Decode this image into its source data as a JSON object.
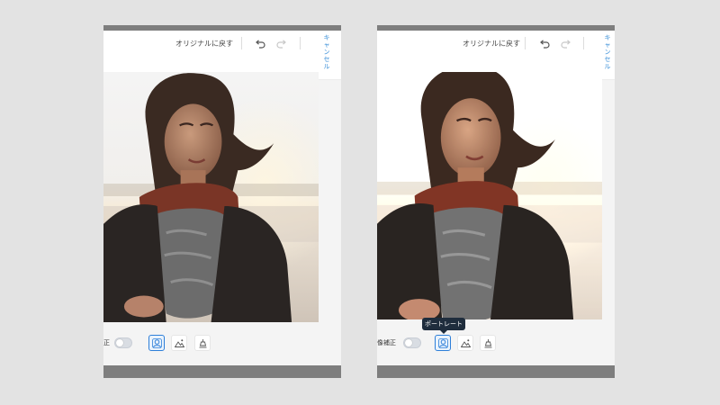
{
  "left": {
    "revert_label": "オリジナルに戻す",
    "cancel_label": "キャンセル",
    "toolbar_label": "正",
    "auto_correct_enabled": false
  },
  "right": {
    "revert_label": "オリジナルに戻す",
    "cancel_label": "キャンセル",
    "toolbar_label": "像補正",
    "auto_correct_enabled": false,
    "tooltip": "ポートレート"
  },
  "icons": [
    "undo-icon",
    "redo-icon",
    "portrait-icon",
    "landscape-icon",
    "product-icon"
  ],
  "colors": {
    "accent": "#2e7fd9",
    "cancel_text": "#3b8fd8",
    "tooltip_bg": "#1f2d3d",
    "background": "#e3e3e3"
  }
}
